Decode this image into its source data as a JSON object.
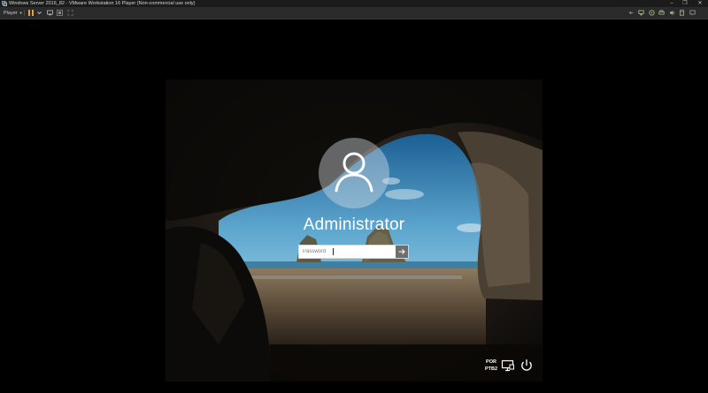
{
  "window": {
    "title": "Windows Server 2016_82 - VMware Workstation 16 Player (Non-commercial use only)",
    "controls": [
      "minimize-icon",
      "maximize-icon",
      "close-icon"
    ]
  },
  "toolbar": {
    "player_menu": "Player",
    "left_icons": [
      "pause-icon",
      "dropdown-icon",
      "send-ctrl-alt-del-icon",
      "unity-icon"
    ],
    "right_icons": [
      "back-icon",
      "network-adapter-icon",
      "removable-device-icon",
      "printer-icon",
      "sound-icon",
      "usb-icon"
    ]
  },
  "login": {
    "username": "Administrator",
    "password_value": "",
    "password_placeholder": "Password",
    "submit_icon": "arrow-right-icon",
    "language_line1": "POR",
    "language_line2": "PTB2",
    "network_icon": "network-icon",
    "ease_of_access_icon": "ease-of-access-icon",
    "power_icon": "power-icon",
    "avatar_icon": "user-icon"
  },
  "colors": {
    "titlebar_bg": "#1b1b1b",
    "toolbar_bg": "#2b2b2b",
    "pause_accent": "#e8a03c",
    "avatar_bg": "#dce1e8"
  }
}
